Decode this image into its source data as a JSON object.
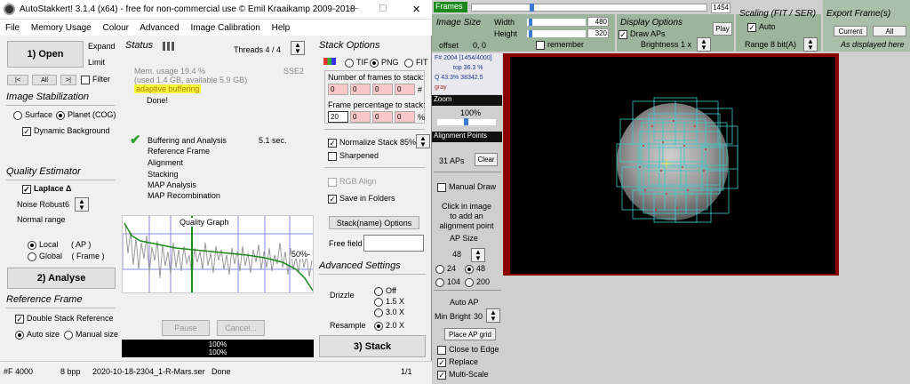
{
  "titlebar": {
    "title": "AutoStakkert! 3.1.4 (x64) - free for non-commercial use © Emil Kraaikamp 2009-2018",
    "min": "—",
    "max": "☐",
    "close": "✕"
  },
  "menu": [
    "File",
    "Memory Usage",
    "Colour",
    "Advanced",
    "Image Calibration",
    "Help"
  ],
  "open": {
    "label": "1) Open",
    "expand": "Expand",
    "limit": "Limit",
    "nav_first": "|<",
    "nav_all": "All",
    "nav_last": ">|",
    "filter": "Filter"
  },
  "stabilization": {
    "heading": "Image Stabilization",
    "surface": "Surface",
    "planet": "Planet (COG)",
    "dynbg": "Dynamic Background"
  },
  "quality": {
    "heading": "Quality Estimator",
    "laplace": "Laplace Δ",
    "noise_label": "Noise Robust",
    "noise_value": "6",
    "range": "Normal range",
    "local": "Local",
    "local_hint": "( AP )",
    "global": "Global",
    "global_hint": "( Frame )"
  },
  "analyse": {
    "label": "2) Analyse"
  },
  "refframe": {
    "heading": "Reference Frame",
    "double": "Double Stack Reference",
    "autosize": "Auto size",
    "manualsize": "Manual size"
  },
  "status": {
    "heading": "Status",
    "threads": "Threads 4 / 4",
    "mem1": "Mem. usage 19.4 %",
    "mem2": "(used 1.4 GB, available 5.9 GB)",
    "sse": "SSE2",
    "buffering": "adaptive buffering",
    "done": "Done!",
    "steps": [
      "Buffering and Analysis",
      "Reference Frame",
      "Alignment",
      "Stacking",
      "MAP Analysis",
      "MAP Recombination"
    ],
    "time": "5.1 sec.",
    "graph_title": "Quality Graph",
    "graph_pct": "50%-",
    "pause": "Pause",
    "cancel": "Cancel...",
    "prog1": "100%",
    "prog2": "100%"
  },
  "stack": {
    "heading": "Stack Options",
    "tif": "TIF",
    "png": "PNG",
    "fit": "FIT",
    "nframes": "Number of frames to stack:",
    "nframes_vals": [
      "0",
      "0",
      "0",
      "0"
    ],
    "hash": "#",
    "pct": "Frame percentage to stack:",
    "pct_vals": [
      "20",
      "0",
      "0",
      "0"
    ],
    "pctsign": "%",
    "normalize": "Normalize Stack 85%",
    "sharpened": "Sharpened",
    "rgbalign": "RGB Align",
    "savefolders": "Save in Folders",
    "stackname": "Stack(name) Options",
    "freefield": "Free field"
  },
  "advanced": {
    "heading": "Advanced Settings",
    "drizzle": "Drizzle",
    "off": "Off",
    "d15": "1.5 X",
    "d30": "3.0 X",
    "resample": "Resample",
    "r20": "2.0 X",
    "stack": "3) Stack"
  },
  "statusbar": {
    "frame": "#F 4000",
    "bpp": "8 bpp",
    "file": "2020-10-18-2304_1-R-Mars.ser",
    "state": "Done",
    "page": "1/1"
  },
  "frames": {
    "label": "Frames",
    "value": "1454",
    "progress": 0.25
  },
  "imagesize": {
    "heading": "Image Size",
    "width_label": "Width",
    "width": "480",
    "height_label": "Height",
    "height": "320",
    "offset_label": "offset",
    "offset": "0, 0",
    "remember": "remember"
  },
  "display": {
    "heading": "Display Options",
    "drawaps": "Draw APs",
    "play": "Play",
    "brightness": "Brightness 1 x"
  },
  "scaling": {
    "heading": "Scaling (FIT / SER)",
    "auto": "Auto",
    "range": "Range 8 bit(A)"
  },
  "export": {
    "heading": "Export Frame(s)",
    "current": "Current",
    "all": "All",
    "asdisplayed": "As displayed here"
  },
  "frameinfo": {
    "f": "F# 2004 [1454/4000]",
    "top": "top 36.3 %",
    "q": "Q 43.3%  38342.5",
    "gray": "gray"
  },
  "zoom": {
    "heading": "Zoom",
    "value": "100%"
  },
  "ap": {
    "heading": "Alignment Points",
    "count": "31 APs",
    "clear": "Clear",
    "manual": "Manual Draw",
    "hint": "Click in image to add an alignment point",
    "size_label": "AP Size",
    "size": "48",
    "s24": "24",
    "s48": "48",
    "s104": "104",
    "s200": "200",
    "autoap": "Auto AP",
    "minbright_label": "Min Bright",
    "minbright": "30",
    "place": "Place AP grid",
    "close": "Close to Edge",
    "replace": "Replace",
    "multiscale": "Multi-Scale"
  },
  "colors": {
    "accent_green": "#1a8a1a",
    "panel_green": "#9bb49b",
    "dark_red": "#8b0000",
    "box_cyan": "#40c8c8"
  }
}
